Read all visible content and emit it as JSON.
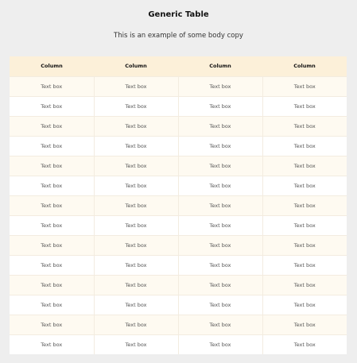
{
  "page": {
    "title": "Generic Table",
    "subtitle": "This is an example of some body copy"
  },
  "table": {
    "columns": [
      "Column",
      "Column",
      "Column",
      "Column"
    ],
    "rows": [
      [
        "Text box",
        "Text box",
        "Text box",
        "Text box"
      ],
      [
        "Text box",
        "Text box",
        "Text box",
        "Text box"
      ],
      [
        "Text box",
        "Text box",
        "Text box",
        "Text box"
      ],
      [
        "Text box",
        "Text box",
        "Text box",
        "Text box"
      ],
      [
        "Text box",
        "Text box",
        "Text box",
        "Text box"
      ],
      [
        "Text box",
        "Text box",
        "Text box",
        "Text box"
      ],
      [
        "Text box",
        "Text box",
        "Text box",
        "Text box"
      ],
      [
        "Text box",
        "Text box",
        "Text box",
        "Text box"
      ],
      [
        "Text box",
        "Text box",
        "Text box",
        "Text box"
      ],
      [
        "Text box",
        "Text box",
        "Text box",
        "Text box"
      ],
      [
        "Text box",
        "Text box",
        "Text box",
        "Text box"
      ],
      [
        "Text box",
        "Text box",
        "Text box",
        "Text box"
      ],
      [
        "Text box",
        "Text box",
        "Text box",
        "Text box"
      ],
      [
        "Text box",
        "Text box",
        "Text box",
        "Text box"
      ]
    ]
  },
  "colors": {
    "background": "#eeeeee",
    "header_row": "#fcf0d9",
    "odd_row": "#fefaf1",
    "even_row": "#ffffff"
  }
}
